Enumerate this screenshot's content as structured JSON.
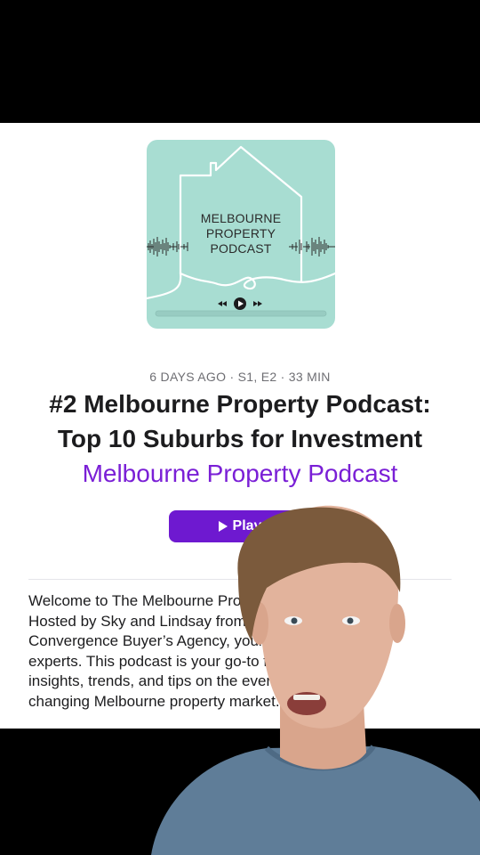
{
  "artwork": {
    "title_lines": [
      "MELBOURNE",
      "PROPERTY",
      "PODCAST"
    ],
    "colors": {
      "background": "#a8ddd2",
      "line": "#ffffff",
      "text": "#2b2b2b"
    },
    "icons": [
      "house-outline-icon",
      "waveform-icon",
      "rewind-icon",
      "play-circle-icon",
      "fast-forward-icon"
    ]
  },
  "episode": {
    "meta": "6 DAYS AGO · S1, E2 · 33 MIN",
    "title_lines": [
      "#2 Melbourne Property Podcast:",
      "Top 10 Suburbs for Investment"
    ],
    "show_name": "Melbourne Property Podcast"
  },
  "play_button": {
    "label": "Play",
    "icon": "play-icon",
    "color": "#6e19d0"
  },
  "description_lines": [
    "Welcome to The Melbourne Property Podcast!",
    "Hosted by Sky and Lindsay from",
    "Convergence Buyer’s Agency, your property",
    "experts. This podcast is your go-to for",
    "insights, trends, and tips on the ever-",
    "changing Melbourne property market."
  ],
  "colors": {
    "accent": "#7a1fd6",
    "meta_text": "#6e6e73"
  }
}
